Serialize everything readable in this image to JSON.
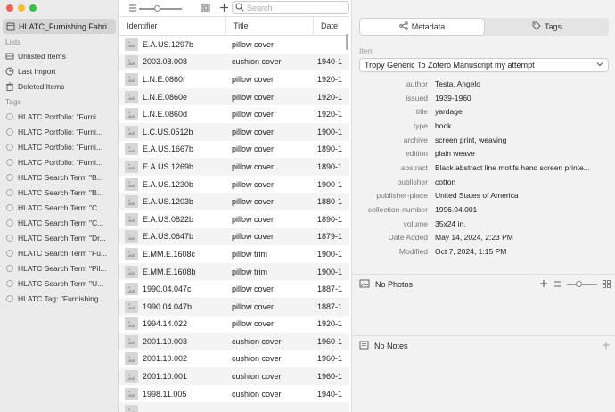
{
  "sidebar": {
    "project": "HLATC_Furnishing Fabri...",
    "lists_header": "Lists",
    "lists": [
      "Unlisted Items",
      "Last Import",
      "Deleted Items"
    ],
    "tags_header": "Tags",
    "tags": [
      "HLATC Portfolio: \"Furni...",
      "HLATC Portfolio: \"Furni...",
      "HLATC Portfolio: \"Furni...",
      "HLATC Portfolio: \"Furni...",
      "HLATC Search Term \"B...",
      "HLATC Search Term \"B...",
      "HLATC Search Term \"C...",
      "HLATC Search Term \"C...",
      "HLATC Search Term \"Dr...",
      "HLATC Search Term \"Fu...",
      "HLATC Search Term \"Pil...",
      "HLATC Search Term \"U...",
      "HLATC Tag: \"Furnishing..."
    ]
  },
  "toolbar": {
    "search_placeholder": "Search"
  },
  "table": {
    "columns": [
      "Identifier",
      "Title",
      "Date"
    ],
    "rows": [
      {
        "id": "E.A.US.1297b",
        "title": "pillow cover",
        "date": ""
      },
      {
        "id": "2003.08.008",
        "title": "cushion cover",
        "date": "1940-1"
      },
      {
        "id": "L.N.E.0860f",
        "title": "pillow cover",
        "date": "1920-1"
      },
      {
        "id": "L.N.E.0860e",
        "title": "pillow cover",
        "date": "1920-1"
      },
      {
        "id": "L.N.E.0860d",
        "title": "pillow cover",
        "date": "1920-1"
      },
      {
        "id": "L.C.US.0512b",
        "title": "pillow cover",
        "date": "1900-1"
      },
      {
        "id": "E.A.US.1667b",
        "title": "pillow cover",
        "date": "1890-1"
      },
      {
        "id": "E.A.US.1269b",
        "title": "pillow cover",
        "date": "1890-1"
      },
      {
        "id": "E.A.US.1230b",
        "title": "pillow cover",
        "date": "1900-1"
      },
      {
        "id": "E.A.US.1203b",
        "title": "pillow cover",
        "date": "1880-1"
      },
      {
        "id": "E.A.US.0822b",
        "title": "pillow cover",
        "date": "1890-1"
      },
      {
        "id": "E.A.US.0647b",
        "title": "pillow cover",
        "date": "1879-1"
      },
      {
        "id": "E.MM.E.1608c",
        "title": "pillow trim",
        "date": "1900-1"
      },
      {
        "id": "E.MM.E.1608b",
        "title": "pillow trim",
        "date": "1900-1"
      },
      {
        "id": "1990.04.047c",
        "title": "pillow cover",
        "date": "1887-1"
      },
      {
        "id": "1990.04.047b",
        "title": "pillow cover",
        "date": "1887-1"
      },
      {
        "id": "1994.14.022",
        "title": "pillow cover",
        "date": "1920-1"
      },
      {
        "id": "2001.10.003",
        "title": "cushion cover",
        "date": "1960-1"
      },
      {
        "id": "2001.10.002",
        "title": "cushion cover",
        "date": "1960-1"
      },
      {
        "id": "2001.10.001",
        "title": "cushion cover",
        "date": "1960-1"
      },
      {
        "id": "1998.11.005",
        "title": "cushion cover",
        "date": "1940-1"
      },
      {
        "id": "",
        "title": "",
        "date": ""
      }
    ]
  },
  "right": {
    "tab_metadata": "Metadata",
    "tab_tags": "Tags",
    "item_label": "Item",
    "item_type": "Tropy Generic To Zotero Manuscript my attempt",
    "fields": [
      {
        "name": "author",
        "value": "Testa, Angelo"
      },
      {
        "name": "issued",
        "value": "1939-1960"
      },
      {
        "name": "title",
        "value": "yardage"
      },
      {
        "name": "type",
        "value": "book"
      },
      {
        "name": "archive",
        "value": "screen print, weaving"
      },
      {
        "name": "edition",
        "value": "plain weave"
      },
      {
        "name": "abstract",
        "value": "Black abstract line motifs hand screen printe..."
      },
      {
        "name": "publisher",
        "value": "cotton"
      },
      {
        "name": "publisher-place",
        "value": "United States of America"
      },
      {
        "name": "collection-number",
        "value": "1996.04.001"
      },
      {
        "name": "volume",
        "value": "35x24 in."
      },
      {
        "name": "Date Added",
        "value": "May 14, 2024, 2:23 PM"
      },
      {
        "name": "Modified",
        "value": "Oct 7, 2024, 1:15 PM"
      }
    ],
    "photos_label": "No Photos",
    "notes_label": "No Notes"
  }
}
